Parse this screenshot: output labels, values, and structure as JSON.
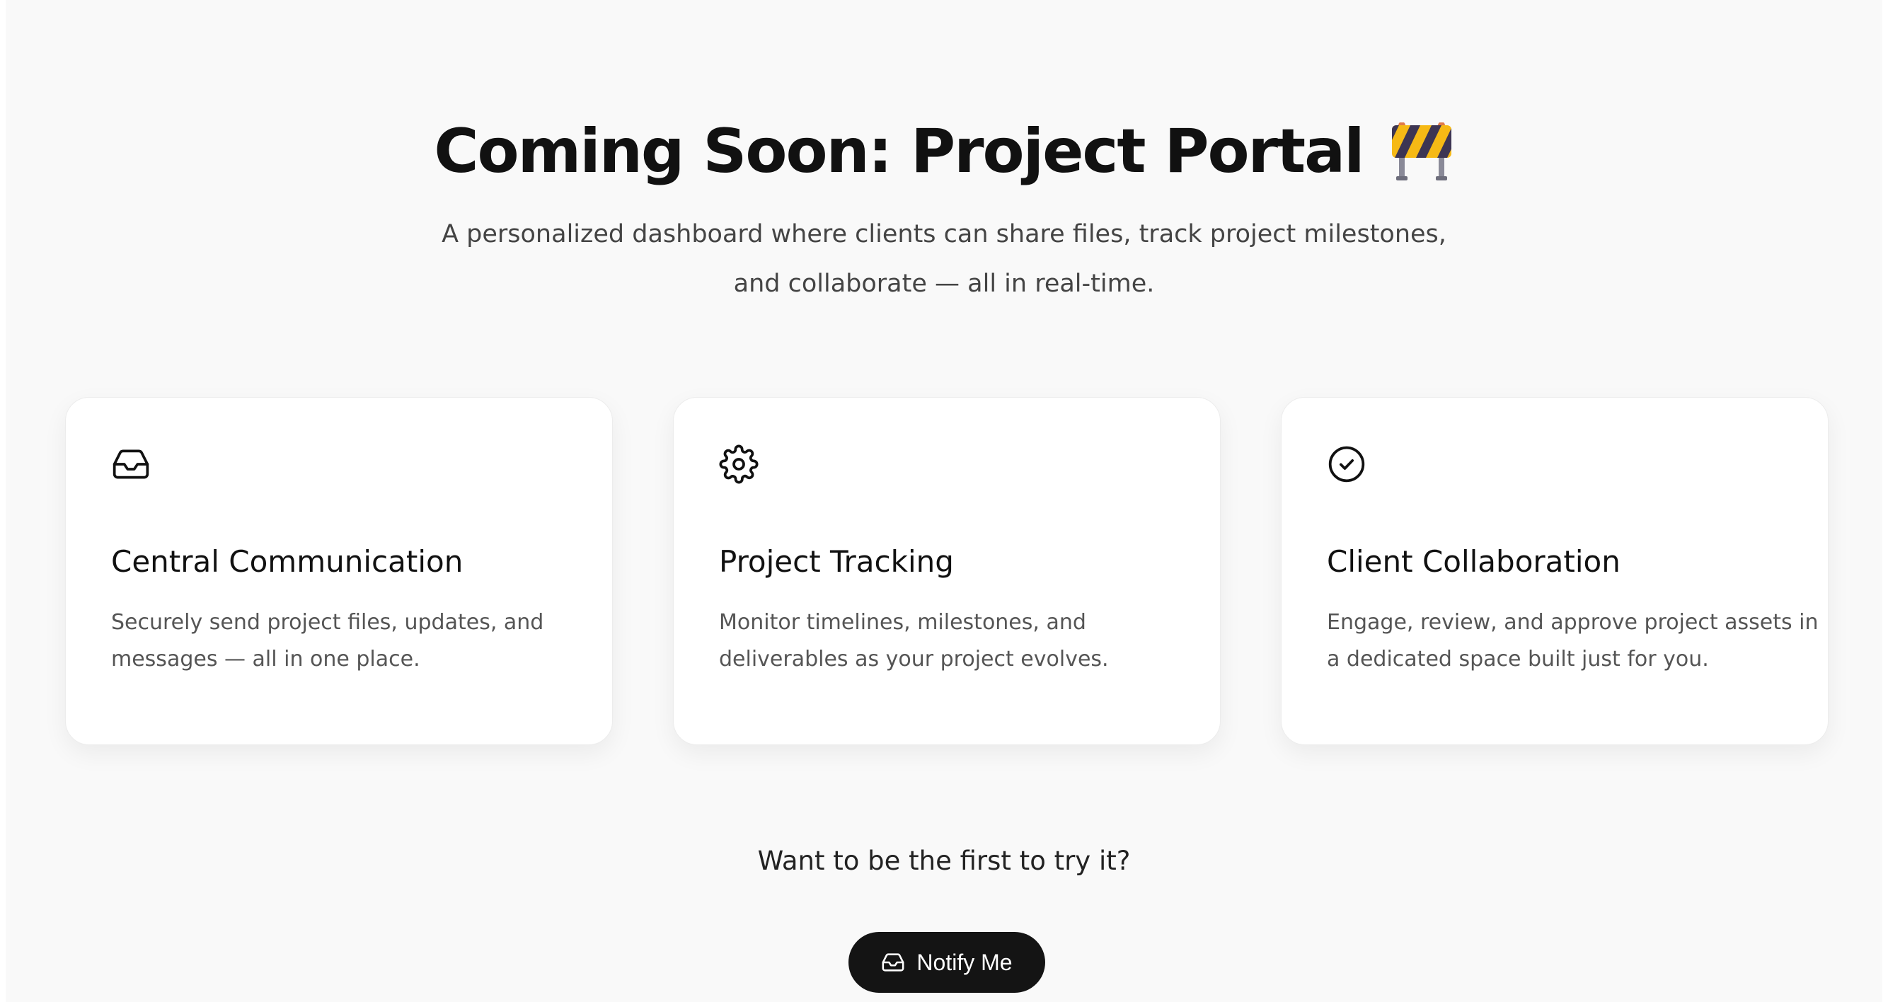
{
  "hero": {
    "title": "Coming Soon: Project Portal",
    "title_icon": "construction-barrier-icon",
    "subtitle_line1": "A personalized dashboard where clients can share files, track project milestones,",
    "subtitle_line2": "and collaborate — all in real-time."
  },
  "features": [
    {
      "icon": "inbox-icon",
      "title": "Central Communication",
      "desc_line1": "Securely send project files, updates, and",
      "desc_line2": "messages — all in one place."
    },
    {
      "icon": "gear-icon",
      "title": "Project Tracking",
      "desc_line1": "Monitor timelines, milestones, and",
      "desc_line2": "deliverables as your project evolves."
    },
    {
      "icon": "check-circle-icon",
      "title": "Client Collaboration",
      "desc_line1": "Engage, review, and approve project assets in",
      "desc_line2": "a dedicated space built just for you."
    }
  ],
  "cta": {
    "prompt": "Want to be the first to try it?",
    "button_label": "Notify Me",
    "button_icon": "inbox-icon"
  },
  "colors": {
    "page_background": "#f9f9f9",
    "card_background": "#ffffff",
    "button_background": "#141414",
    "heading_text": "#111111",
    "body_text": "#555555"
  }
}
